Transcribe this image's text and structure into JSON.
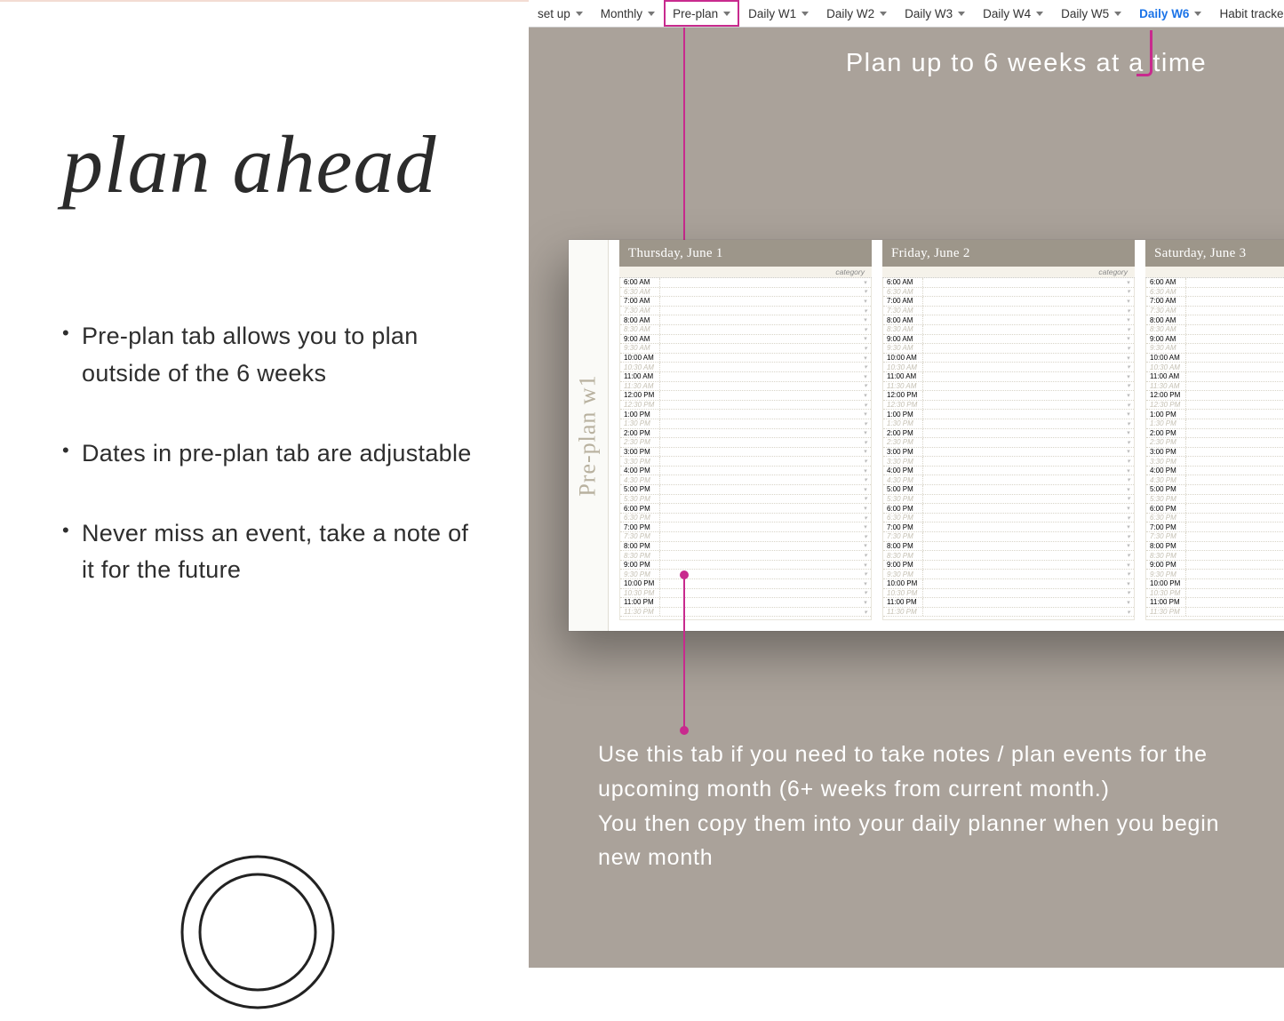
{
  "left": {
    "title": "plan ahead",
    "bullets": [
      "Pre-plan tab allows you to plan outside of the 6 weeks",
      "Dates in pre-plan tab are adjustable",
      "Never miss an event, take a note of it for the future"
    ]
  },
  "tabs": [
    {
      "label": "set up",
      "caret": true
    },
    {
      "label": "Monthly",
      "caret": true
    },
    {
      "label": "Pre-plan",
      "caret": true,
      "highlight": true
    },
    {
      "label": "Daily W1",
      "caret": true
    },
    {
      "label": "Daily W2",
      "caret": true
    },
    {
      "label": "Daily W3",
      "caret": true
    },
    {
      "label": "Daily W4",
      "caret": true
    },
    {
      "label": "Daily W5",
      "caret": true
    },
    {
      "label": "Daily W6",
      "caret": true,
      "blue": true
    },
    {
      "label": "Habit tracker",
      "caret": false
    }
  ],
  "headline": "Plan up to 6 weeks at a time",
  "sheet": {
    "side_label": "Pre-plan w1",
    "category_label": "category",
    "days": [
      {
        "title": "Thursday, June 1"
      },
      {
        "title": "Friday, June 2"
      },
      {
        "title": "Saturday, June 3"
      }
    ],
    "times": [
      "6:00 AM",
      "6:30 AM",
      "7:00 AM",
      "7:30 AM",
      "8:00 AM",
      "8:30 AM",
      "9:00 AM",
      "9:30 AM",
      "10:00 AM",
      "10:30 AM",
      "11:00 AM",
      "11:30 AM",
      "12:00 PM",
      "12:30 PM",
      "1:00 PM",
      "1:30 PM",
      "2:00 PM",
      "2:30 PM",
      "3:00 PM",
      "3:30 PM",
      "4:00 PM",
      "4:30 PM",
      "5:00 PM",
      "5:30 PM",
      "6:00 PM",
      "6:30 PM",
      "7:00 PM",
      "7:30 PM",
      "8:00 PM",
      "8:30 PM",
      "9:00 PM",
      "9:30 PM",
      "10:00 PM",
      "10:30 PM",
      "11:00 PM",
      "11:30 PM"
    ]
  },
  "bottom_copy_line1": "Use this tab if you need to take notes / plan events for the upcoming month (6+ weeks from current month.)",
  "bottom_copy_line2": "You then copy them into your daily planner when you begin new month"
}
